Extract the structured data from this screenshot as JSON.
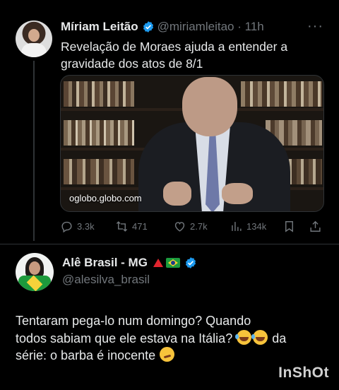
{
  "tweet_1": {
    "author_name": "Míriam Leitão",
    "handle_time": "@miriamleitao · 11h",
    "more": "···",
    "text_line1": "Revelação de Moraes ajuda a entender a",
    "text_line2": "gravidade dos atos de 8/1",
    "media_caption": "oglobo.globo.com",
    "replies": "3.3k",
    "retweets": "471",
    "likes": "2.7k",
    "views": "134k"
  },
  "tweet_2": {
    "author_name": "Alê Brasil - MG",
    "handle": "@alesilva_brasil",
    "text_line1": "Tentaram pega-lo num domingo?  Quando",
    "text_line2_a": "todos sabiam que ele estava na Itália?",
    "text_line2_b": "da",
    "text_line3": "série: o barba é inocente"
  },
  "watermark": "InShOt",
  "colors": {
    "background": "#000000",
    "text": "#e7e9ea",
    "muted": "#71767b",
    "verified_blue": "#1d9bf0"
  },
  "icons": [
    "verified-badge-icon",
    "reply-icon",
    "retweet-icon",
    "like-icon",
    "views-icon",
    "bookmark-icon",
    "share-icon",
    "red-triangle-icon",
    "brazil-flag-icon",
    "laughing-emoji-icon",
    "wink-tongue-emoji-icon"
  ]
}
